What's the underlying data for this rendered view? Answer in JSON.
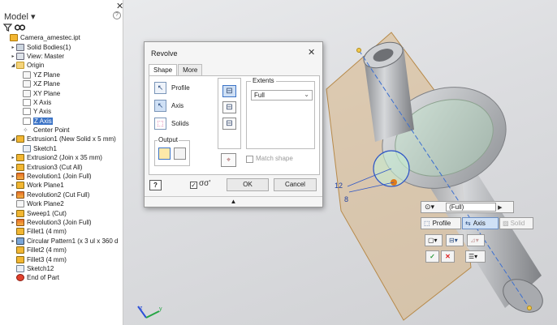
{
  "browser": {
    "title": "Model ▾",
    "close_glyph": "✕",
    "help_glyph": "?",
    "filter_icon": "filter-icon",
    "search_icon": "search-icon",
    "items": [
      {
        "label": "Camera_amestec.ipt",
        "indent": 0,
        "exp": "",
        "icon": "part"
      },
      {
        "label": "Solid Bodies(1)",
        "indent": 1,
        "exp": "▸",
        "icon": "solids"
      },
      {
        "label": "View: Master",
        "indent": 1,
        "exp": "▸",
        "icon": "view"
      },
      {
        "label": "Origin",
        "indent": 1,
        "exp": "◢",
        "icon": "folder"
      },
      {
        "label": "YZ Plane",
        "indent": 2,
        "exp": "",
        "icon": "plane"
      },
      {
        "label": "XZ Plane",
        "indent": 2,
        "exp": "",
        "icon": "plane"
      },
      {
        "label": "XY Plane",
        "indent": 2,
        "exp": "",
        "icon": "plane"
      },
      {
        "label": "X Axis",
        "indent": 2,
        "exp": "",
        "icon": "axis"
      },
      {
        "label": "Y Axis",
        "indent": 2,
        "exp": "",
        "icon": "axis"
      },
      {
        "label": "Z Axis",
        "indent": 2,
        "exp": "",
        "icon": "axis",
        "selected": true
      },
      {
        "label": "Center Point",
        "indent": 2,
        "exp": "",
        "icon": "point"
      },
      {
        "label": "Extrusion1 (New Solid x 5 mm)",
        "indent": 1,
        "exp": "◢",
        "icon": "feature"
      },
      {
        "label": "Sketch1",
        "indent": 2,
        "exp": "",
        "icon": "sketch"
      },
      {
        "label": "Extrusion2 (Join x 35 mm)",
        "indent": 1,
        "exp": "▸",
        "icon": "feature"
      },
      {
        "label": "Extrusion3 (Cut All)",
        "indent": 1,
        "exp": "▸",
        "icon": "feature"
      },
      {
        "label": "Revolution1 (Join Full)",
        "indent": 1,
        "exp": "▸",
        "icon": "revolve"
      },
      {
        "label": "Work Plane1",
        "indent": 1,
        "exp": "▸",
        "icon": "feature"
      },
      {
        "label": "Revolution2 (Cut Full)",
        "indent": 1,
        "exp": "▸",
        "icon": "revolve"
      },
      {
        "label": "Work Plane2",
        "indent": 1,
        "exp": "",
        "icon": "plane"
      },
      {
        "label": "Sweep1 (Cut)",
        "indent": 1,
        "exp": "▸",
        "icon": "feature"
      },
      {
        "label": "Revolution3 (Join Full)",
        "indent": 1,
        "exp": "▸",
        "icon": "revolve"
      },
      {
        "label": "Fillet1 (4 mm)",
        "indent": 1,
        "exp": "",
        "icon": "feature"
      },
      {
        "label": "Circular Pattern1 (x 3 ul x 360 d",
        "indent": 1,
        "exp": "▸",
        "icon": "pattern"
      },
      {
        "label": "Fillet2 (4 mm)",
        "indent": 1,
        "exp": "",
        "icon": "feature"
      },
      {
        "label": "Fillet3 (4 mm)",
        "indent": 1,
        "exp": "",
        "icon": "feature"
      },
      {
        "label": "Sketch12",
        "indent": 1,
        "exp": "",
        "icon": "sketch"
      },
      {
        "label": "End of Part",
        "indent": 1,
        "exp": "",
        "icon": "eop"
      }
    ]
  },
  "dialog": {
    "title": "Revolve",
    "close_glyph": "✕",
    "tabs": [
      "Shape",
      "More"
    ],
    "profile_label": "Profile",
    "axis_label": "Axis",
    "solids_label": "Solids",
    "output_label": "Output",
    "extents_label": "Extents",
    "extents_value": "Full",
    "match_shape_label": "Match shape",
    "help_glyph": "?",
    "preview_check": "✓",
    "preview_glyph": "σσ'",
    "ok_label": "OK",
    "cancel_label": "Cancel",
    "expand_glyph": "▲"
  },
  "viewport": {
    "dim_label_1": "12",
    "dim_label_2": "8"
  },
  "minitoolbar": {
    "extents_value": "(Full)",
    "profile_label": "Profile",
    "axis_label": "Axis",
    "solids_label": "Solid",
    "ok_glyph": "✓",
    "cancel_glyph": "✕"
  },
  "colors": {
    "selection": "#3b73c6",
    "part_body": "#c9cbcf",
    "sketch_plane": "#d7b58a",
    "axis_line": "#3b6fd0",
    "highlight_green": "#b9e8c5"
  }
}
